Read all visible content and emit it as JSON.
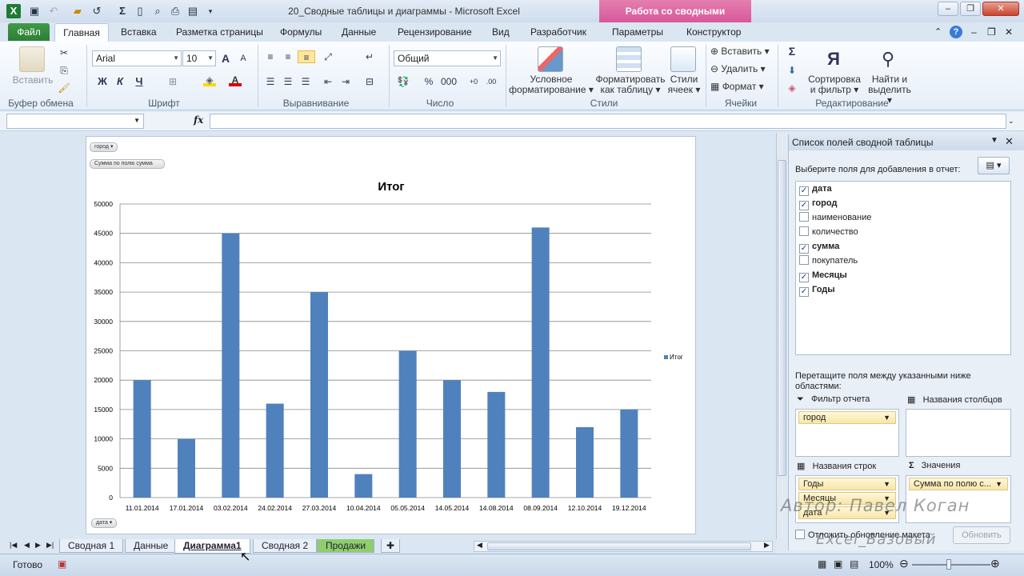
{
  "window": {
    "title": "20_Сводные таблицы и диаграммы  -  Microsoft Excel",
    "context_tab": "Работа со сводными таблицами"
  },
  "tabs": [
    "Файл",
    "Главная",
    "Вставка",
    "Разметка страницы",
    "Формулы",
    "Данные",
    "Рецензирование",
    "Вид",
    "Разработчик",
    "Параметры",
    "Конструктор"
  ],
  "ribbon": {
    "paste": "Вставить",
    "font_name": "Arial",
    "font_size": "10",
    "number_format": "Общий",
    "bold": "Ж",
    "italic": "К",
    "underline": "Ч",
    "percent": "%",
    "thousands": "000",
    "cond_format": [
      "Условное",
      "форматирование"
    ],
    "format_table": [
      "Форматировать",
      "как таблицу"
    ],
    "cell_styles": [
      "Стили",
      "ячеек"
    ],
    "insert": "Вставить",
    "delete": "Удалить",
    "format": "Формат",
    "sort": [
      "Сортировка",
      "и фильтр"
    ],
    "find": [
      "Найти и",
      "выделить"
    ],
    "groups": [
      "Буфер обмена",
      "Шрифт",
      "Выравнивание",
      "Число",
      "Стили",
      "Ячейки",
      "Редактирование"
    ]
  },
  "formula_bar": {
    "fx": "fx",
    "name_box": "",
    "content": ""
  },
  "chart_buttons": {
    "filter": "город",
    "values": "Сумма по полю сумма",
    "axis": "дата"
  },
  "chart_data": {
    "type": "bar",
    "title": "Итог",
    "categories": [
      "11.01.2014",
      "17.01.2014",
      "03.02.2014",
      "24.02.2014",
      "27.03.2014",
      "10.04.2014",
      "05.05.2014",
      "14.05.2014",
      "14.08.2014",
      "08.09.2014",
      "12.10.2014",
      "19.12.2014"
    ],
    "series": [
      {
        "name": "Итог",
        "values": [
          20000,
          10000,
          45000,
          16000,
          35000,
          4000,
          25000,
          20000,
          18000,
          46000,
          12000,
          15000
        ],
        "color": "#4f81bd"
      }
    ],
    "yticks": [
      "0",
      "5000",
      "10000",
      "15000",
      "20000",
      "25000",
      "30000",
      "35000",
      "40000",
      "45000",
      "50000"
    ],
    "ylim": [
      0,
      50000
    ],
    "grid": true,
    "legend": "right"
  },
  "panel": {
    "title": "Список полей сводной таблицы",
    "choose_label": "Выберите поля для добавления в отчет:",
    "fields": [
      {
        "name": "дата",
        "checked": true
      },
      {
        "name": "город",
        "checked": true
      },
      {
        "name": "наименование",
        "checked": false
      },
      {
        "name": "количество",
        "checked": false
      },
      {
        "name": "сумма",
        "checked": true
      },
      {
        "name": "покупатель",
        "checked": false
      },
      {
        "name": "Месяцы",
        "checked": true
      },
      {
        "name": "Годы",
        "checked": true
      }
    ],
    "drag_label": "Перетащите поля между указанными ниже областями:",
    "areas": {
      "filter": {
        "label": "Фильтр отчета",
        "items": [
          "город"
        ]
      },
      "columns": {
        "label": "Названия столбцов",
        "items": []
      },
      "rows": {
        "label": "Названия строк",
        "items": [
          "Годы",
          "Месяцы",
          "дата"
        ]
      },
      "values": {
        "label": "Значения",
        "items": [
          "Сумма по полю с..."
        ]
      }
    },
    "defer_label": "Отложить обновление макета",
    "update_label": "Обновить"
  },
  "sheets": [
    "Сводная 1",
    "Данные",
    "Диаграмма1",
    "Сводная 2",
    "Продажи"
  ],
  "active_sheet": "Диаграмма1",
  "status": {
    "ready": "Готово",
    "zoom": "100%"
  },
  "watermark": {
    "author": "Автор: Павел Коган",
    "course": "Excel_Базовый"
  }
}
